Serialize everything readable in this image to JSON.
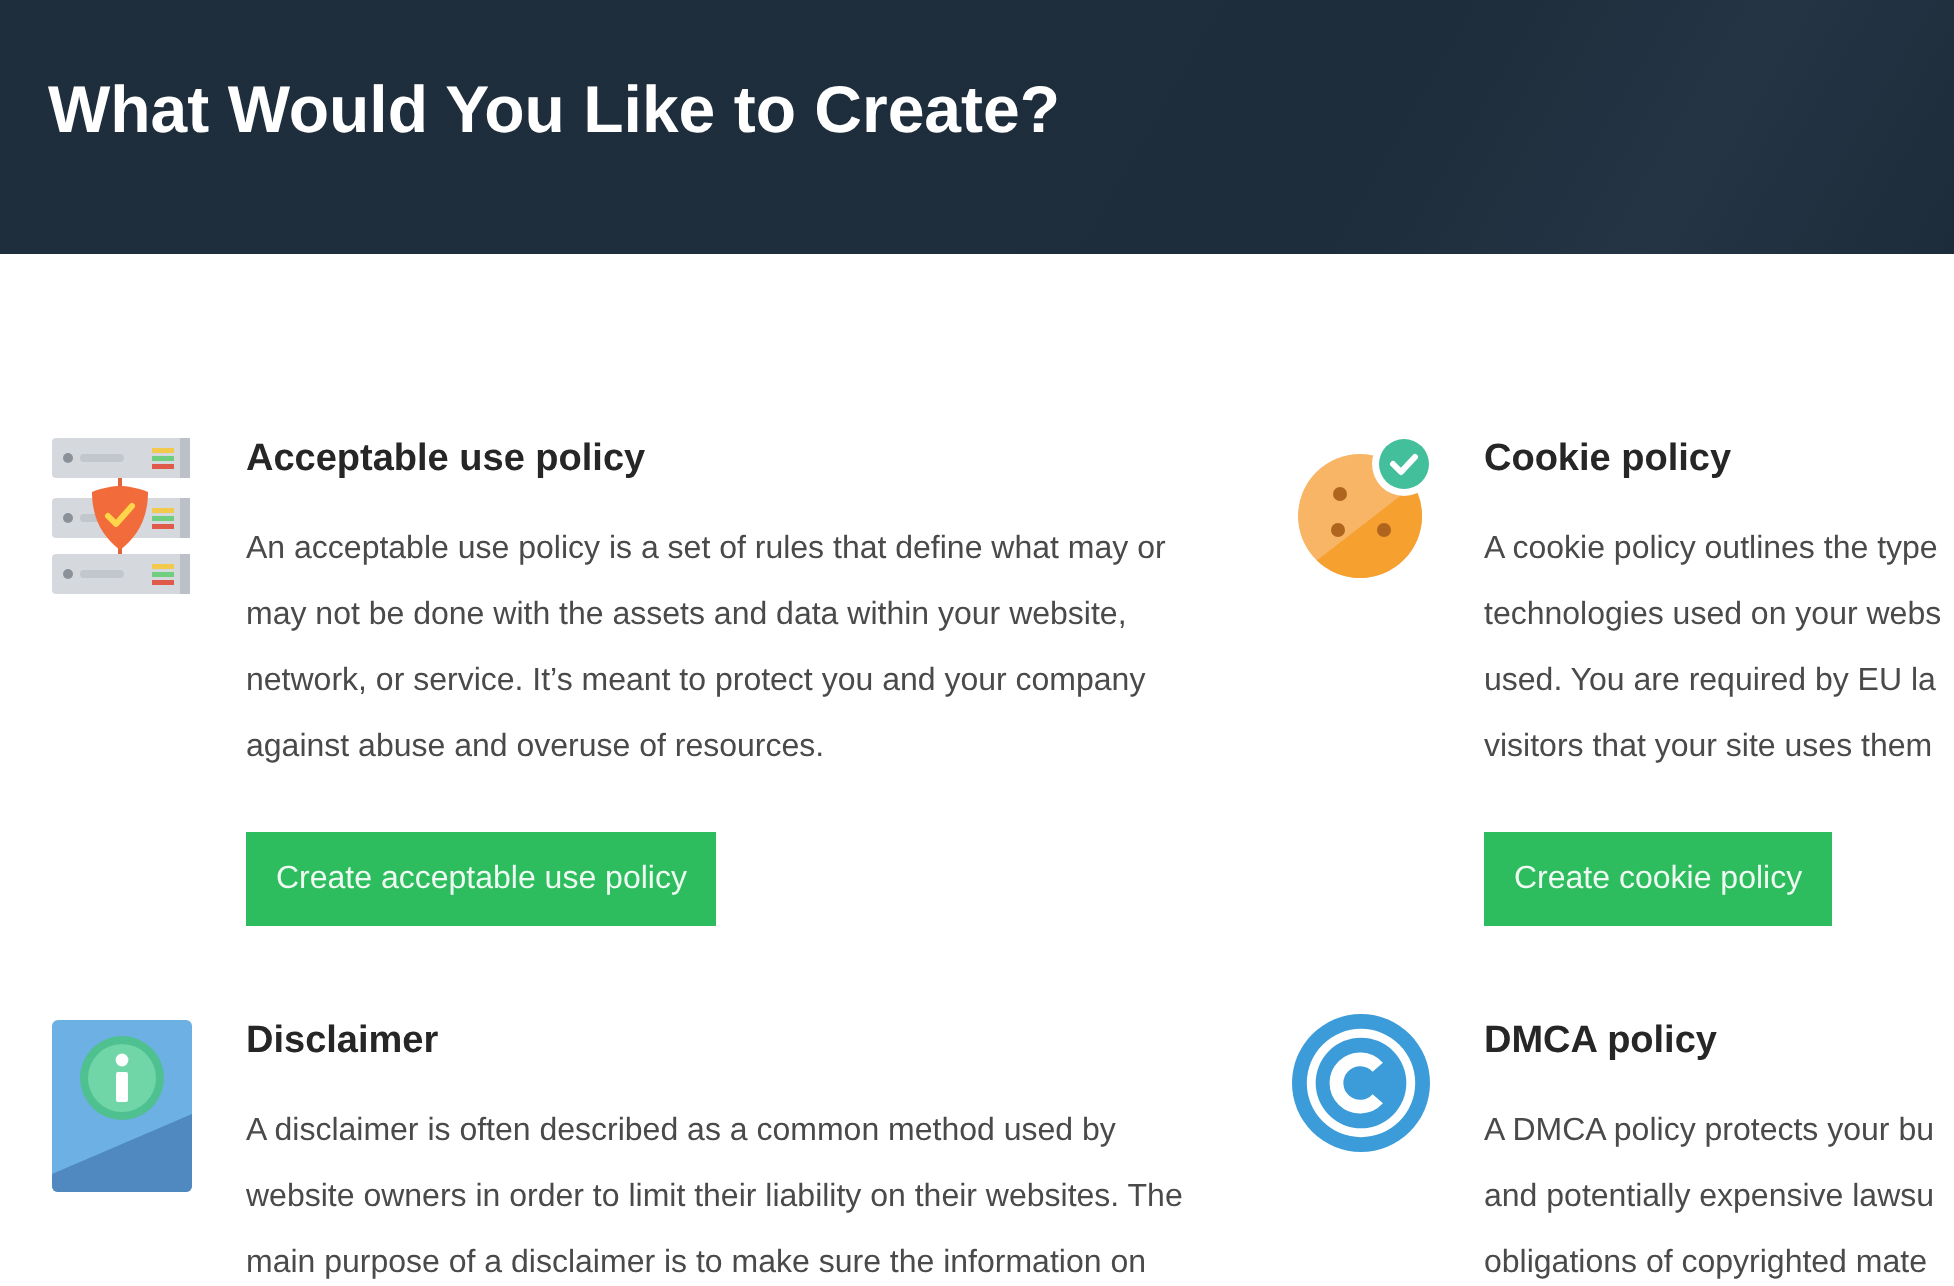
{
  "header": {
    "title": "What Would You Like to Create?"
  },
  "policies": [
    {
      "kind": "acceptable-use",
      "title": "Acceptable use policy",
      "description_lines": [
        "An acceptable use policy is a set of rules that define what may or",
        "may not be done with the assets and data within your website,",
        "network, or service. It’s meant to protect you and your company",
        "against abuse and overuse of resources."
      ],
      "button": "Create acceptable use policy"
    },
    {
      "kind": "cookie",
      "title": "Cookie policy",
      "description_lines": [
        "A cookie policy outlines the type",
        "technologies used on your webs",
        "used. You are required by EU la",
        "visitors that your site uses them"
      ],
      "button": "Create cookie policy"
    },
    {
      "kind": "disclaimer",
      "title": "Disclaimer",
      "description_lines": [
        "A disclaimer is often described as a common method used by",
        "website owners in order to limit their liability on their websites. The",
        "main purpose of a disclaimer is to make sure the information on"
      ]
    },
    {
      "kind": "dmca",
      "title": "DMCA policy",
      "description_lines": [
        "A DMCA policy protects your bu",
        "and potentially expensive lawsu",
        "obligations of copyrighted mate"
      ]
    }
  ]
}
